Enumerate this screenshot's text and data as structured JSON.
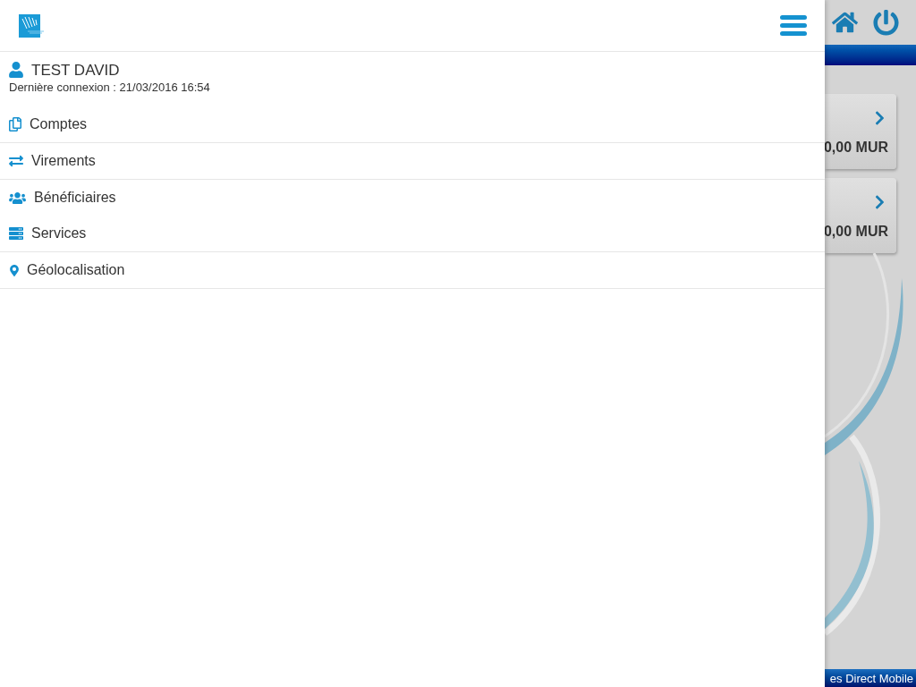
{
  "drawer": {
    "user": {
      "name": "TEST DAVID",
      "last_login": "Dernière connexion : 21/03/2016 16:54"
    },
    "menu_groups": [
      {
        "items": [
          {
            "label": "Comptes"
          }
        ]
      },
      {
        "items": [
          {
            "label": "Virements"
          }
        ]
      },
      {
        "items": [
          {
            "label": "Bénéficiaires"
          },
          {
            "label": "Services"
          }
        ]
      },
      {
        "items": [
          {
            "label": "Géolocalisation"
          }
        ]
      }
    ]
  },
  "background_screen": {
    "cards": [
      {
        "amount": "0,00 MUR"
      },
      {
        "amount": "0,00 MUR"
      }
    ],
    "footer": "es Direct Mobile"
  }
}
